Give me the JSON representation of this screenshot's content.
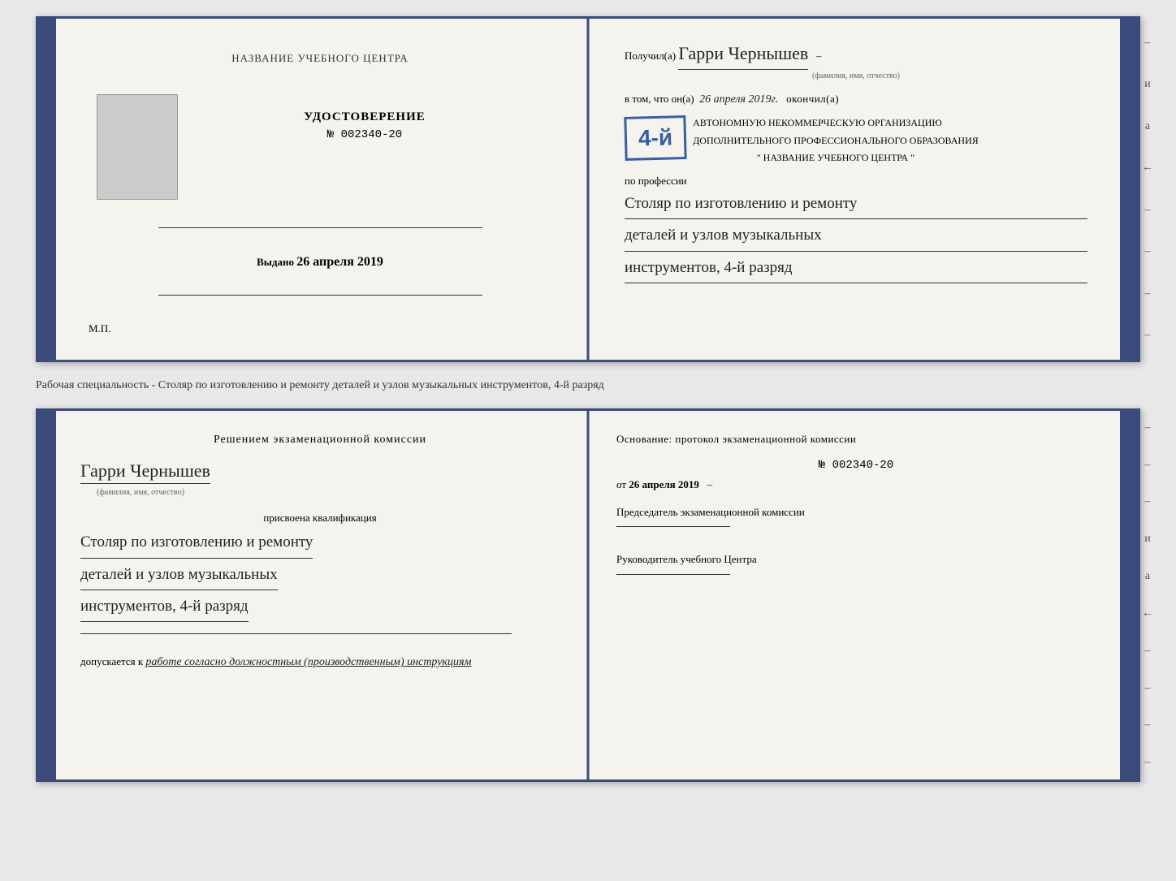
{
  "top_booklet": {
    "left_page": {
      "center_name": "НАЗВАНИЕ УЧЕБНОГО ЦЕНТРА",
      "cert_title": "УДОСТОВЕРЕНИЕ",
      "cert_number": "№ 002340-20",
      "issued_label": "Выдано",
      "issued_date": "26 апреля 2019",
      "mp_label": "М.П."
    },
    "right_page": {
      "received_prefix": "Получил(а)",
      "recipient_name": "Гарри Чернышев",
      "name_subtitle": "(фамилия, имя, отчество)",
      "vtom_prefix": "в том, что он(а)",
      "date_value": "26 апреля 2019г.",
      "okoncil": "окончил(а)",
      "stamp_number": "4-й",
      "stamp_line1": "АВТОНОМНУЮ НЕКОММЕРЧЕСКУЮ ОРГАНИЗАЦИЮ",
      "stamp_line2": "ДОПОЛНИТЕЛЬНОГО ПРОФЕССИОНАЛЬНОГО ОБРАЗОВАНИЯ",
      "stamp_line3": "\" НАЗВАНИЕ УЧЕБНОГО ЦЕНТРА \"",
      "profession_label": "по профессии",
      "profession_line1": "Столяр по изготовлению и ремонту",
      "profession_line2": "деталей и узлов музыкальных",
      "profession_line3": "инструментов, 4-й разряд"
    },
    "right_marks": [
      "–",
      "и",
      "а",
      "←",
      "–",
      "–",
      "–",
      "–"
    ]
  },
  "caption": "Рабочая специальность - Столяр по изготовлению и ремонту деталей и узлов музыкальных инструментов, 4-й разряд",
  "bottom_booklet": {
    "left_page": {
      "decision_header": "Решением  экзаменационной  комиссии",
      "person_name": "Гарри Чернышев",
      "name_subtitle": "(фамилия, имя, отчество)",
      "qualification_label": "присвоена квалификация",
      "profession_line1": "Столяр по изготовлению и ремонту",
      "profession_line2": "деталей и узлов музыкальных",
      "profession_line3": "инструментов, 4-й разряд",
      "допускается_prefix": "допускается к",
      "допускается_text": "работе согласно должностным (производственным) инструкциям"
    },
    "right_page": {
      "osnov_text": "Основание: протокол  экзаменационной  комиссии",
      "protocol_number": "№  002340-20",
      "date_prefix": "от",
      "date_value": "26 апреля 2019",
      "chairman_label": "Председатель экзаменационной комиссии",
      "manager_label": "Руководитель учебного Центра"
    },
    "right_marks": [
      "–",
      "–",
      "–",
      "и",
      "а",
      "←",
      "–",
      "–",
      "–",
      "–"
    ]
  }
}
